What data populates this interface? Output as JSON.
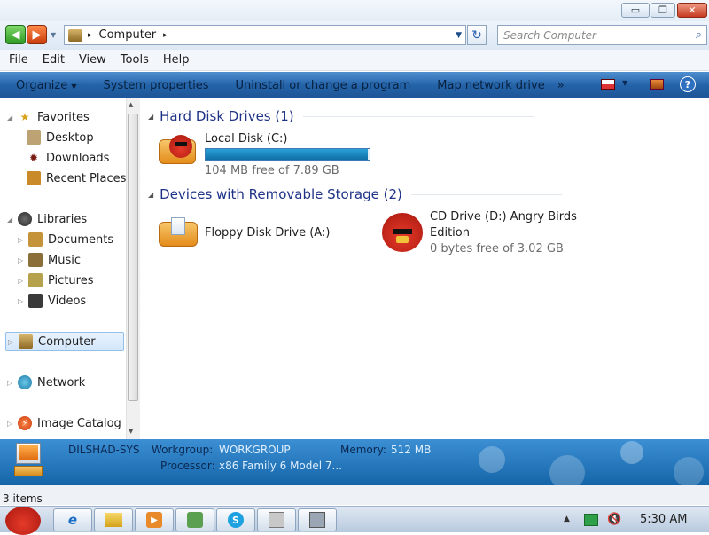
{
  "window": {
    "minimize_label": "▭",
    "maximize_label": "❐",
    "close_label": "✕"
  },
  "address": {
    "crumb": "Computer",
    "chevron": "▸"
  },
  "search": {
    "placeholder": "Search Computer"
  },
  "menu": {
    "items": [
      "File",
      "Edit",
      "View",
      "Tools",
      "Help"
    ]
  },
  "commands": {
    "organize": "Organize",
    "system_properties": "System properties",
    "uninstall": "Uninstall or change a program",
    "map_drive": "Map network drive",
    "overflow": "»"
  },
  "nav": {
    "favorites": "Favorites",
    "desktop": "Desktop",
    "downloads": "Downloads",
    "recent": "Recent Places",
    "libraries": "Libraries",
    "documents": "Documents",
    "music": "Music",
    "pictures": "Pictures",
    "videos": "Videos",
    "computer": "Computer",
    "network": "Network",
    "image_catalog": "Image Catalog"
  },
  "content": {
    "hdd_group": "Hard Disk Drives (1)",
    "removable_group": "Devices with Removable Storage (2)",
    "local_disk": {
      "name": "Local Disk (C:)",
      "free": "104 MB free of 7.89 GB",
      "used_fraction": 0.987
    },
    "floppy": {
      "name": "Floppy Disk Drive (A:)"
    },
    "cd": {
      "name_line1": "CD Drive (D:) Angry Birds",
      "name_line2": "Edition",
      "free": "0 bytes free of 3.02 GB"
    }
  },
  "details": {
    "computer_name": "DILSHAD-SYS",
    "workgroup_label": "Workgroup:",
    "workgroup": "WORKGROUP",
    "memory_label": "Memory:",
    "memory": "512 MB",
    "processor_label": "Processor:",
    "processor": "x86 Family 6 Model 7..."
  },
  "status": {
    "items": "3 items"
  },
  "taskbar": {
    "time": "5:30 AM"
  },
  "colors": {
    "accent": "#1e3287",
    "command_bar": "#2463a8",
    "progress": "#0e6fa5"
  }
}
